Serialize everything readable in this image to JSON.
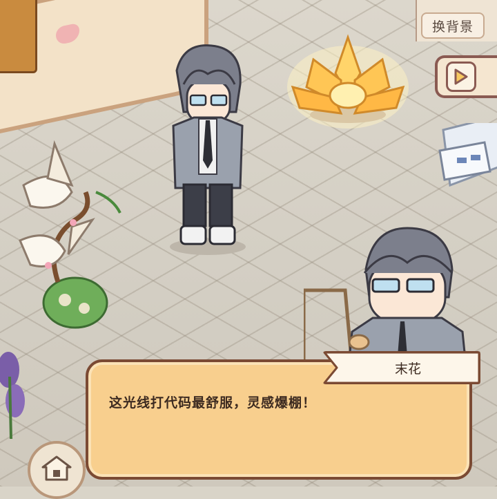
{
  "toolbar": {
    "change_background_label": "换背景"
  },
  "dialog": {
    "speaker_name": "末花",
    "text": "这光线打代码最舒服，灵感爆棚！"
  },
  "icons": {
    "play": "play-icon",
    "home": "home-icon"
  },
  "colors": {
    "dialog_fill": "#f8cf8e",
    "dialog_border": "#7b4a33",
    "name_tab_fill": "#fdf6ea",
    "button_accent": "#8a5a52"
  }
}
